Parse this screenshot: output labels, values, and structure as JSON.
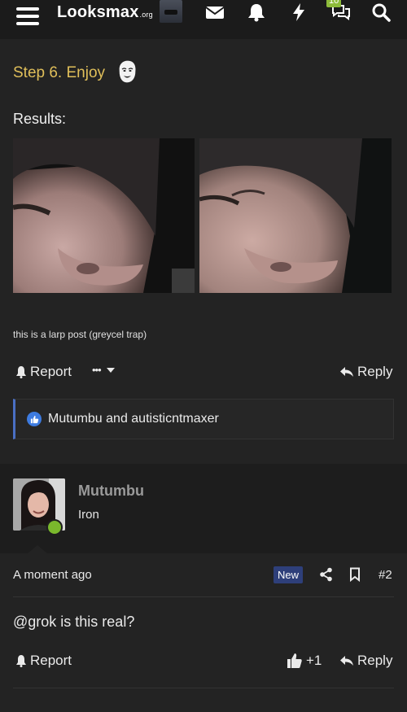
{
  "header": {
    "logo_main": "Looksmax",
    "logo_suffix": ".org",
    "conversations_count": "10"
  },
  "post1": {
    "step_text": "Step 6. Enjoy",
    "results_label": "Results:",
    "caption": "this is a larp post (greycel trap)",
    "report_label": "Report",
    "more_label": "•••",
    "reply_label": "Reply",
    "likes_text": "Mutumbu and autisticntmaxer"
  },
  "post2": {
    "username": "Mutumbu",
    "user_title": "Iron",
    "timestamp": "A moment ago",
    "new_badge": "New",
    "post_number": "#2",
    "message": "@grok is this real?",
    "report_label": "Report",
    "plus_one": "+1",
    "reply_label": "Reply"
  },
  "colors": {
    "accent_gold": "#e0bf5a",
    "online_green": "#7ab82c",
    "like_blue": "#3d7be0",
    "new_badge_bg": "#2e3f7a"
  },
  "icons": [
    "hamburger-icon",
    "envelope-icon",
    "bell-icon",
    "bolt-icon",
    "chat-icon",
    "search-icon",
    "share-icon",
    "bookmark-icon",
    "thumbs-up-icon",
    "reply-icon"
  ]
}
